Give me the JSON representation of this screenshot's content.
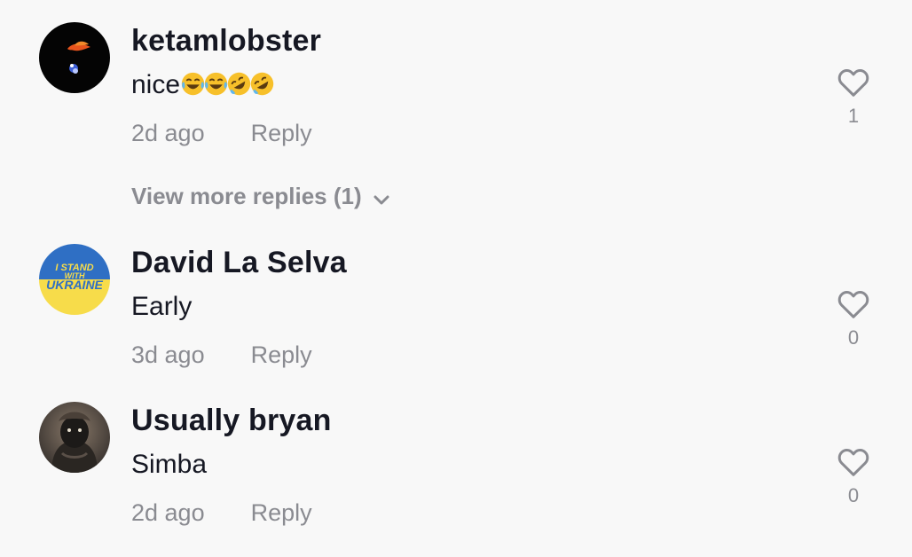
{
  "comments": [
    {
      "username": "ketamlobster",
      "text": "nice",
      "emojis": [
        "face-with-tears-of-joy",
        "face-with-tears-of-joy",
        "rolling-on-the-floor-laughing",
        "rolling-on-the-floor-laughing"
      ],
      "time": "2d ago",
      "reply_label": "Reply",
      "likes": "1",
      "view_more": "View more replies (1)"
    },
    {
      "username": "David La Selva",
      "text": "Early",
      "avatar_text": [
        "I STAND",
        "WITH",
        "UKRAINE"
      ],
      "time": "3d ago",
      "reply_label": "Reply",
      "likes": "0"
    },
    {
      "username": "Usually bryan",
      "text": "Simba",
      "time": "2d ago",
      "reply_label": "Reply",
      "likes": "0"
    }
  ],
  "colors": {
    "background": "#f8f8f8",
    "text_primary": "#161823",
    "text_secondary": "#8a8b91",
    "ukraine_blue": "#2f6fc4",
    "ukraine_yellow": "#f7dc4a"
  },
  "icons": [
    "heart-outline-icon",
    "chevron-down-icon"
  ]
}
